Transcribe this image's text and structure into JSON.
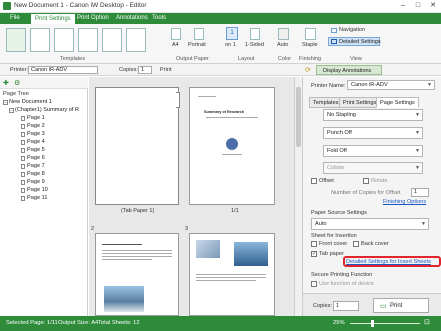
{
  "window": {
    "title": "New Document 1 - Canon iW Desktop - Editor",
    "min": "–",
    "max": "□",
    "close": "✕"
  },
  "menu": {
    "tabs": [
      "File",
      "Print Settings",
      "Print Option",
      "Annotations",
      "Tools"
    ],
    "active": "Print Settings"
  },
  "ribbon": {
    "groups": {
      "templates": "Templates",
      "output_paper": "Output Paper",
      "layout": "Layout",
      "color": "Color",
      "finishing": "Finishing",
      "view": "View"
    },
    "paper_size": "A4",
    "orientation": "Portrait",
    "pages_per_sheet": "1",
    "pages_per_sheet_sub": "on 1",
    "print_sides": "1-Sided",
    "color_mode": "Auto",
    "staple": "Staple",
    "navigation": "Navigation",
    "detailed_settings": "Detailed Settings"
  },
  "toolbar": {
    "printer_label": "Printer:",
    "printer_value": "Canon iR-ADV",
    "copies_label": "Copies:",
    "copies_value": "1",
    "print_label": "Print",
    "display_annotations": "Display Annotations"
  },
  "left": {
    "title": "Page Tree",
    "tree": [
      {
        "label": "New Document 1",
        "type": "root"
      },
      {
        "label": "(Chapter1) Summary of R",
        "type": "chapter"
      },
      {
        "label": "Page 1",
        "type": "page"
      },
      {
        "label": "Page 2",
        "type": "page"
      },
      {
        "label": "Page 3",
        "type": "page"
      },
      {
        "label": "Page 4",
        "type": "page"
      },
      {
        "label": "Page 5",
        "type": "page"
      },
      {
        "label": "Page 6",
        "type": "page"
      },
      {
        "label": "Page 7",
        "type": "page"
      },
      {
        "label": "Page 8",
        "type": "page"
      },
      {
        "label": "Page 9",
        "type": "page"
      },
      {
        "label": "Page 10",
        "type": "page"
      },
      {
        "label": "Page 11",
        "type": "page"
      }
    ]
  },
  "center": {
    "pages": [
      {
        "caption": "(Tab Paper 1)"
      },
      {
        "caption": "1/1",
        "heading": "Summary of Research"
      },
      {
        "caption": "",
        "num": "2"
      },
      {
        "caption": "",
        "num": "3"
      }
    ]
  },
  "right": {
    "printer_name_label": "Printer Name:",
    "printer_name_value": "Canon iR-ADV",
    "tabs": [
      "Templates",
      "Print Settings",
      "Page Settings"
    ],
    "active_tab": "Page Settings",
    "no_stapling": "No Stapling",
    "punch_off": "Punch Off",
    "fold_off": "Fold Off",
    "collate": "Collate",
    "offset": "Offset",
    "rotate": "Rotate",
    "copies_offset_label": "Number of Copies for Offset",
    "copies_offset_value": "1",
    "finishing_options": "Finishing Options",
    "paper_source_label": "Paper Source Settings",
    "paper_source_value": "Auto",
    "sheet_insertion_label": "Sheet for Insertion",
    "front_cover": "Front cover",
    "back_cover": "Back cover",
    "tab_paper": "Tab paper",
    "detailed_insert_link": "Detailed Settings for Insert Sheets",
    "secure_printing": "Secure Printing Function",
    "use_function": "Use function of device",
    "copies_label": "Copies:",
    "copies_value": "1",
    "print_button": "Print"
  },
  "status": {
    "selected": "Selected Page: 1/11",
    "output_size": "Output Size: A4",
    "total_sheets": "Total Sheets: 12",
    "zoom": "25%"
  },
  "colors": {
    "accent": "#2e8b3a",
    "highlight": "#e0262c",
    "link": "#1a56c4"
  }
}
